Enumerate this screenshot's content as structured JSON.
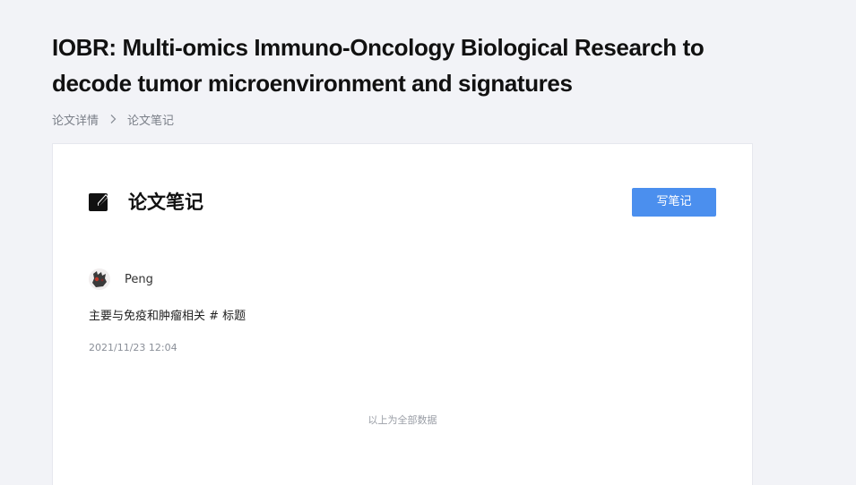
{
  "paper": {
    "title": "IOBR: Multi-omics Immuno-Oncology Biological Research to decode tumor microenvironment and signatures"
  },
  "breadcrumb": {
    "items": [
      "论文详情",
      "论文笔记"
    ],
    "separator_icon": "chevron-right-icon"
  },
  "notes_section": {
    "title": "论文笔记",
    "icon": "edit-note-icon",
    "write_button_label": "写笔记",
    "accent_color": "#4b8fee"
  },
  "notes": [
    {
      "author": "Peng",
      "content": "主要与免疫和肿瘤相关 # 标题",
      "time": "2021/11/23 12:04"
    }
  ],
  "footer": {
    "end_text": "以上为全部数据"
  }
}
